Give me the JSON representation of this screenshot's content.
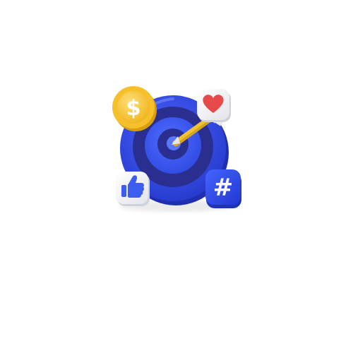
{
  "scene": {
    "subject": "target-marketing-3d-icon",
    "background_color": "#ffffff",
    "elements": {
      "target": {
        "icon": "bullseye-icon",
        "colors": {
          "outer_ring": "#2f46e8",
          "outer_ring_shadow": "#1f2fb0",
          "mid_ring": "#2a2f8f",
          "inner_ring": "#3c5cff",
          "bullseye": "#1d2270"
        }
      },
      "arrow": {
        "icon": "arrow-icon",
        "colors": {
          "shaft": "#f2c230",
          "shaft_shadow": "#d6a51f",
          "fletching": "#ffffff"
        }
      },
      "coin": {
        "icon": "dollar-coin-icon",
        "symbol": "$",
        "colors": {
          "outer": "#f5c02b",
          "inner": "#ffd54a",
          "symbol": "#ffffff"
        }
      },
      "heart_badge": {
        "icon": "heart-icon",
        "colors": {
          "tile": "#f4f4f6",
          "heart": "#e74a4a"
        }
      },
      "like_badge": {
        "icon": "thumbs-up-icon",
        "colors": {
          "tile": "#f4f4f6",
          "thumb": "#3d5cf0"
        }
      },
      "hashtag_badge": {
        "icon": "hashtag-icon",
        "symbol": "#",
        "colors": {
          "tile": "#2f4ff0",
          "tile_shadow": "#1d34b8",
          "symbol": "#ffffff"
        }
      }
    }
  }
}
